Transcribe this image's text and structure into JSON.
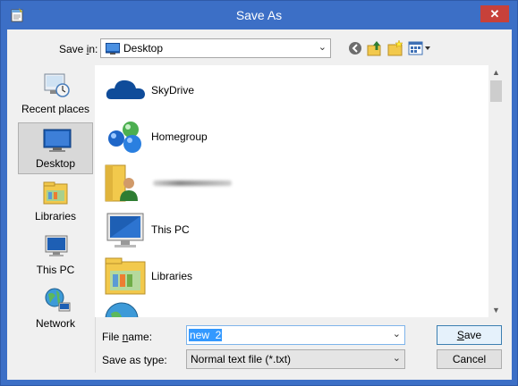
{
  "window": {
    "title": "Save As",
    "close_symbol": "✕",
    "app_icon": "notepad-icon"
  },
  "toolbar": {
    "save_in_label_pre": "Save ",
    "save_in_label_key": "i",
    "save_in_label_post": "n:",
    "location": "Desktop",
    "location_icon": "desktop-icon",
    "tools": [
      "back-icon",
      "up-folder-icon",
      "new-folder-icon",
      "view-menu-icon"
    ]
  },
  "places": [
    {
      "label": "Recent places",
      "icon": "recent-places-icon",
      "active": false
    },
    {
      "label": "Desktop",
      "icon": "desktop-icon",
      "active": true
    },
    {
      "label": "Libraries",
      "icon": "libraries-icon",
      "active": false
    },
    {
      "label": "This PC",
      "icon": "this-pc-icon",
      "active": false
    },
    {
      "label": "Network",
      "icon": "network-icon",
      "active": false
    }
  ],
  "files": [
    {
      "name": "SkyDrive",
      "icon": "skydrive-icon"
    },
    {
      "name": "Homegroup",
      "icon": "homegroup-icon"
    },
    {
      "name": "",
      "icon": "user-folder-icon",
      "redacted": true
    },
    {
      "name": "This PC",
      "icon": "this-pc-icon"
    },
    {
      "name": "Libraries",
      "icon": "libraries-icon"
    }
  ],
  "form": {
    "file_name_label_pre": "File ",
    "file_name_label_key": "n",
    "file_name_label_post": "ame:",
    "file_name_value": "new  2",
    "save_as_type_label": "Save as type:",
    "save_as_type_value": "Normal text file (*.txt)"
  },
  "buttons": {
    "save_key": "S",
    "save_rest": "ave",
    "cancel": "Cancel"
  },
  "colors": {
    "title_bar": "#3c6fc6",
    "close_button": "#c7413a",
    "selection": "#3399ff"
  }
}
